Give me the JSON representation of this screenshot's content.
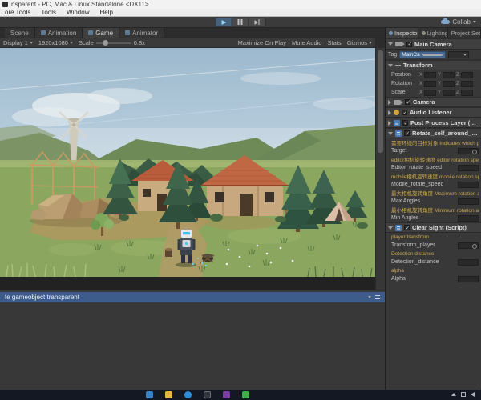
{
  "window": {
    "title": "nsparent - PC, Mac & Linux Standalone <DX11>",
    "menu_items": [
      "ore Tools",
      "Tools",
      "Window",
      "Help"
    ]
  },
  "toolbar": {
    "collab_label": "Collab"
  },
  "view_tabs": [
    {
      "label": "Scene"
    },
    {
      "label": "Animation"
    },
    {
      "label": "Game"
    },
    {
      "label": "Animator"
    }
  ],
  "game_toolbar": {
    "display": "Display 1",
    "resolution": "1920x1080",
    "scale_label": "Scale",
    "scale_value": "0.8x",
    "buttons": {
      "maximize": "Maximize On Play",
      "mute": "Mute Audio",
      "stats": "Stats",
      "gizmos": "Gizmos"
    }
  },
  "inspector": {
    "tabs": [
      {
        "label": "Inspector"
      },
      {
        "label": "Lighting"
      },
      {
        "label": "Project Sett"
      }
    ],
    "object_name": "Main Camera",
    "tag_label": "Tag",
    "tag_value": "MainCamera",
    "transform": {
      "title": "Transform",
      "rows": [
        {
          "label": "Position"
        },
        {
          "label": "Rotation"
        },
        {
          "label": "Scale"
        }
      ],
      "axes": {
        "x": "X",
        "y": "Y",
        "z": "Z"
      }
    },
    "camera_title": "Camera",
    "audio_listener_title": "Audio Listener",
    "post_process_title": "Post Process Layer (Script)",
    "rotate_script": {
      "title": "Rotate_self_around_target_scr",
      "fields": [
        {
          "header": "需要环绕的目标对象 Indicates which point",
          "label": "Target"
        },
        {
          "header": "editor相机旋转速度 editor rotation speed",
          "label": "Editor_rotate_speed"
        },
        {
          "header": "mobile相机旋转速度 mobile rotation speed",
          "label": "Mobile_rotate_speed"
        },
        {
          "header": "最大相机旋转角度 Maximum rotation angle",
          "label": "Max Angles"
        },
        {
          "header": "最小相机旋转角度 Minimum rotation angle",
          "label": "Min Angles"
        }
      ]
    },
    "clear_sight": {
      "title": "Clear Sight (Script)",
      "fields": [
        {
          "header": "player transfrom",
          "label": "Transform_player"
        },
        {
          "header": "Detection distance",
          "label": "Detection_distance"
        },
        {
          "header": "alpha",
          "label": "Alpha"
        }
      ]
    }
  },
  "console": {
    "selected_entry": "te gameobject transparent"
  },
  "taskbar": {
    "icons": [
      {
        "name": "app-blue"
      },
      {
        "name": "file-explorer"
      },
      {
        "name": "edge-browser"
      },
      {
        "name": "terminal"
      },
      {
        "name": "app-purple"
      },
      {
        "name": "app-green"
      }
    ]
  },
  "colors": {
    "selection_blue": "#3d5c8c",
    "inspector_header_yellow": "#c8a550",
    "play_active_blue": "#46617c",
    "script_icon_blue": "#4a7db5",
    "tag_dropdown_blue": "#46688c"
  }
}
